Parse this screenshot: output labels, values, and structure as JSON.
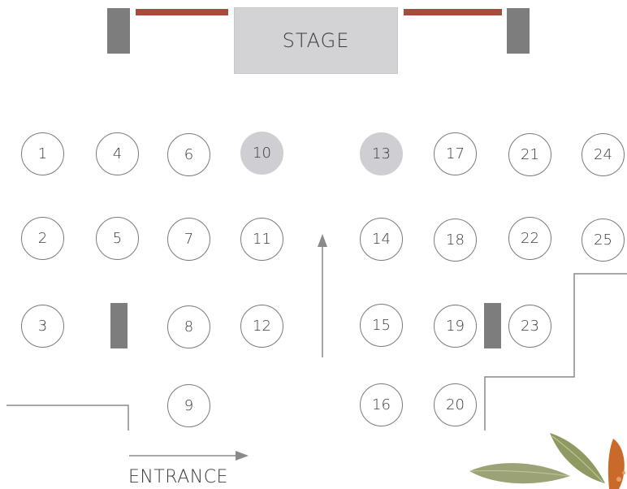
{
  "stage_label": "STAGE",
  "entrance_label": "ENTRANCE",
  "colors": {
    "reserved_table": "#cfcfd3",
    "curtain": "#a94a3d",
    "speaker": "#7d7d7d",
    "outline": "#7a7a7a"
  },
  "tables": [
    {
      "number": "1",
      "status": "open"
    },
    {
      "number": "2",
      "status": "open"
    },
    {
      "number": "3",
      "status": "open"
    },
    {
      "number": "4",
      "status": "open"
    },
    {
      "number": "5",
      "status": "open"
    },
    {
      "number": "6",
      "status": "open"
    },
    {
      "number": "7",
      "status": "open"
    },
    {
      "number": "8",
      "status": "open"
    },
    {
      "number": "9",
      "status": "open"
    },
    {
      "number": "10",
      "status": "reserved"
    },
    {
      "number": "11",
      "status": "open"
    },
    {
      "number": "12",
      "status": "open"
    },
    {
      "number": "13",
      "status": "reserved"
    },
    {
      "number": "14",
      "status": "open"
    },
    {
      "number": "15",
      "status": "open"
    },
    {
      "number": "16",
      "status": "open"
    },
    {
      "number": "17",
      "status": "open"
    },
    {
      "number": "18",
      "status": "open"
    },
    {
      "number": "19",
      "status": "open"
    },
    {
      "number": "20",
      "status": "open"
    },
    {
      "number": "21",
      "status": "open"
    },
    {
      "number": "22",
      "status": "open"
    },
    {
      "number": "23",
      "status": "open"
    },
    {
      "number": "24",
      "status": "open"
    },
    {
      "number": "25",
      "status": "open"
    }
  ]
}
